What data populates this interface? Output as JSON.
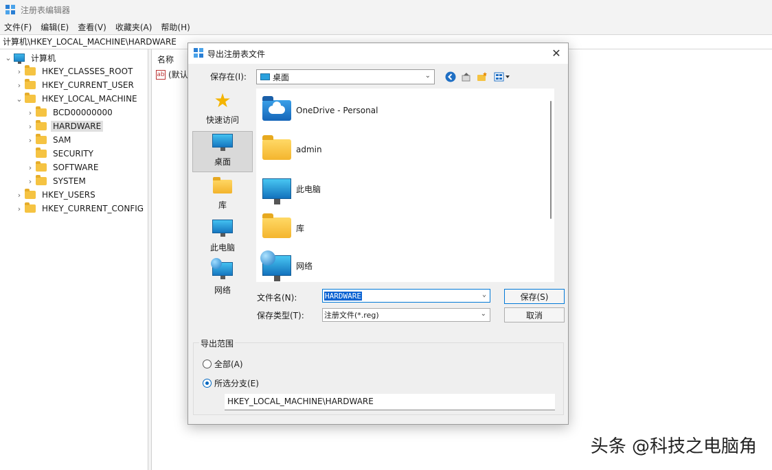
{
  "window": {
    "title": "注册表编辑器",
    "menu": [
      "文件(F)",
      "编辑(E)",
      "查看(V)",
      "收藏夹(A)",
      "帮助(H)"
    ],
    "address": "计算机\\HKEY_LOCAL_MACHINE\\HARDWARE"
  },
  "tree": {
    "root": "计算机",
    "items": [
      {
        "label": "HKEY_CLASSES_ROOT"
      },
      {
        "label": "HKEY_CURRENT_USER"
      },
      {
        "label": "HKEY_LOCAL_MACHINE"
      },
      {
        "label": "BCD00000000"
      },
      {
        "label": "HARDWARE"
      },
      {
        "label": "SAM"
      },
      {
        "label": "SECURITY"
      },
      {
        "label": "SOFTWARE"
      },
      {
        "label": "SYSTEM"
      },
      {
        "label": "HKEY_USERS"
      },
      {
        "label": "HKEY_CURRENT_CONFIG"
      }
    ]
  },
  "values_pane": {
    "column_name": "名称",
    "rows": [
      {
        "name": "(默认"
      }
    ]
  },
  "dialog": {
    "title": "导出注册表文件",
    "close_label": "✕",
    "save_in_label": "保存在(I):",
    "save_in_value": "桌面",
    "places": [
      "快速访问",
      "桌面",
      "库",
      "此电脑",
      "网络"
    ],
    "files": [
      "OneDrive - Personal",
      "admin",
      "此电脑",
      "库",
      "网络"
    ],
    "filename_label": "文件名(N):",
    "filename_value": "HARDWARE",
    "filetype_label": "保存类型(T):",
    "filetype_value": "注册文件(*.reg)",
    "save_button": "保存(S)",
    "cancel_button": "取消",
    "range_title": "导出范围",
    "range_all": "全部(A)",
    "range_selected": "所选分支(E)",
    "branch_value": "HKEY_LOCAL_MACHINE\\HARDWARE"
  },
  "watermark": "头条 @科技之电脑角",
  "colors": {
    "accent": "#0078d7",
    "folder": "#f5c342",
    "selection": "#0a62d2"
  }
}
